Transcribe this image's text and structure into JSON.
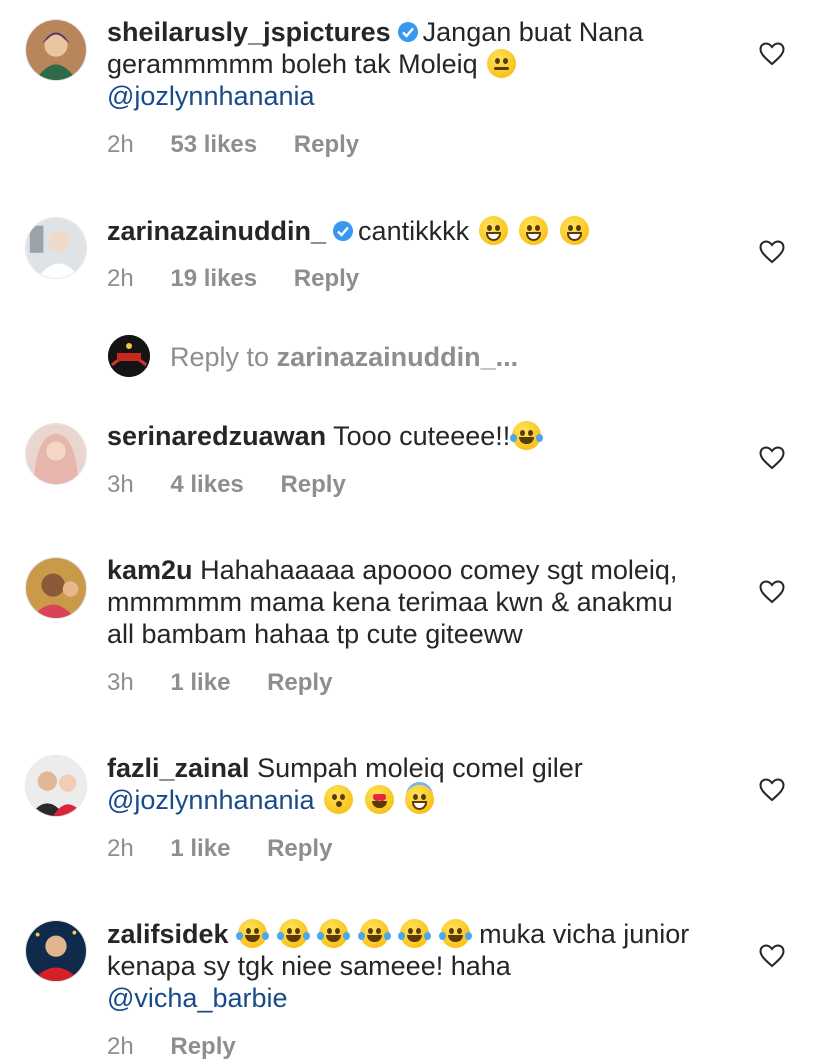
{
  "comments": [
    {
      "username": "sheilarusly_jspictures",
      "verified": true,
      "text_line1": "Jangan buat Nana",
      "text_line2": "gerammmmm boleh tak Moleiq",
      "mention": "@jozlynnhanania",
      "time": "2h",
      "likes": "53 likes",
      "reply": "Reply"
    },
    {
      "username": "zarinazainuddin_",
      "verified": true,
      "text": "cantikkkk",
      "time": "2h",
      "likes": "19 likes",
      "reply": "Reply"
    },
    {
      "username": "serinaredzuawan",
      "verified": false,
      "text": "Tooo cuteeee!!",
      "time": "3h",
      "likes": "4 likes",
      "reply": "Reply"
    },
    {
      "username": "kam2u",
      "verified": false,
      "text_line1": "Hahahaaaaa apoooo comey sgt moleiq,",
      "text_line2": "mmmmmm mama kena terimaa kwn & anakmu",
      "text_line3": "all bambam hahaa tp cute giteeww",
      "time": "3h",
      "likes": "1 like",
      "reply": "Reply"
    },
    {
      "username": "fazli_zainal",
      "verified": false,
      "text": "Sumpah moleiq  comel giler",
      "mention": "@jozlynnhanania",
      "time": "2h",
      "likes": "1 like",
      "reply": "Reply"
    },
    {
      "username": "zalifsidek",
      "verified": false,
      "text_line1": "muka vicha junior",
      "text_line2": "kenapa sy tgk niee sameee! haha",
      "mention": "@vicha_barbie",
      "time": "2h",
      "reply": "Reply"
    }
  ],
  "reply_to": {
    "prefix": "Reply to",
    "target": "zarinazainuddin_..."
  },
  "colors": {
    "text": "#262626",
    "meta": "#8e8e8e",
    "mention": "#1a4a8a",
    "verified": "#3897f0"
  }
}
